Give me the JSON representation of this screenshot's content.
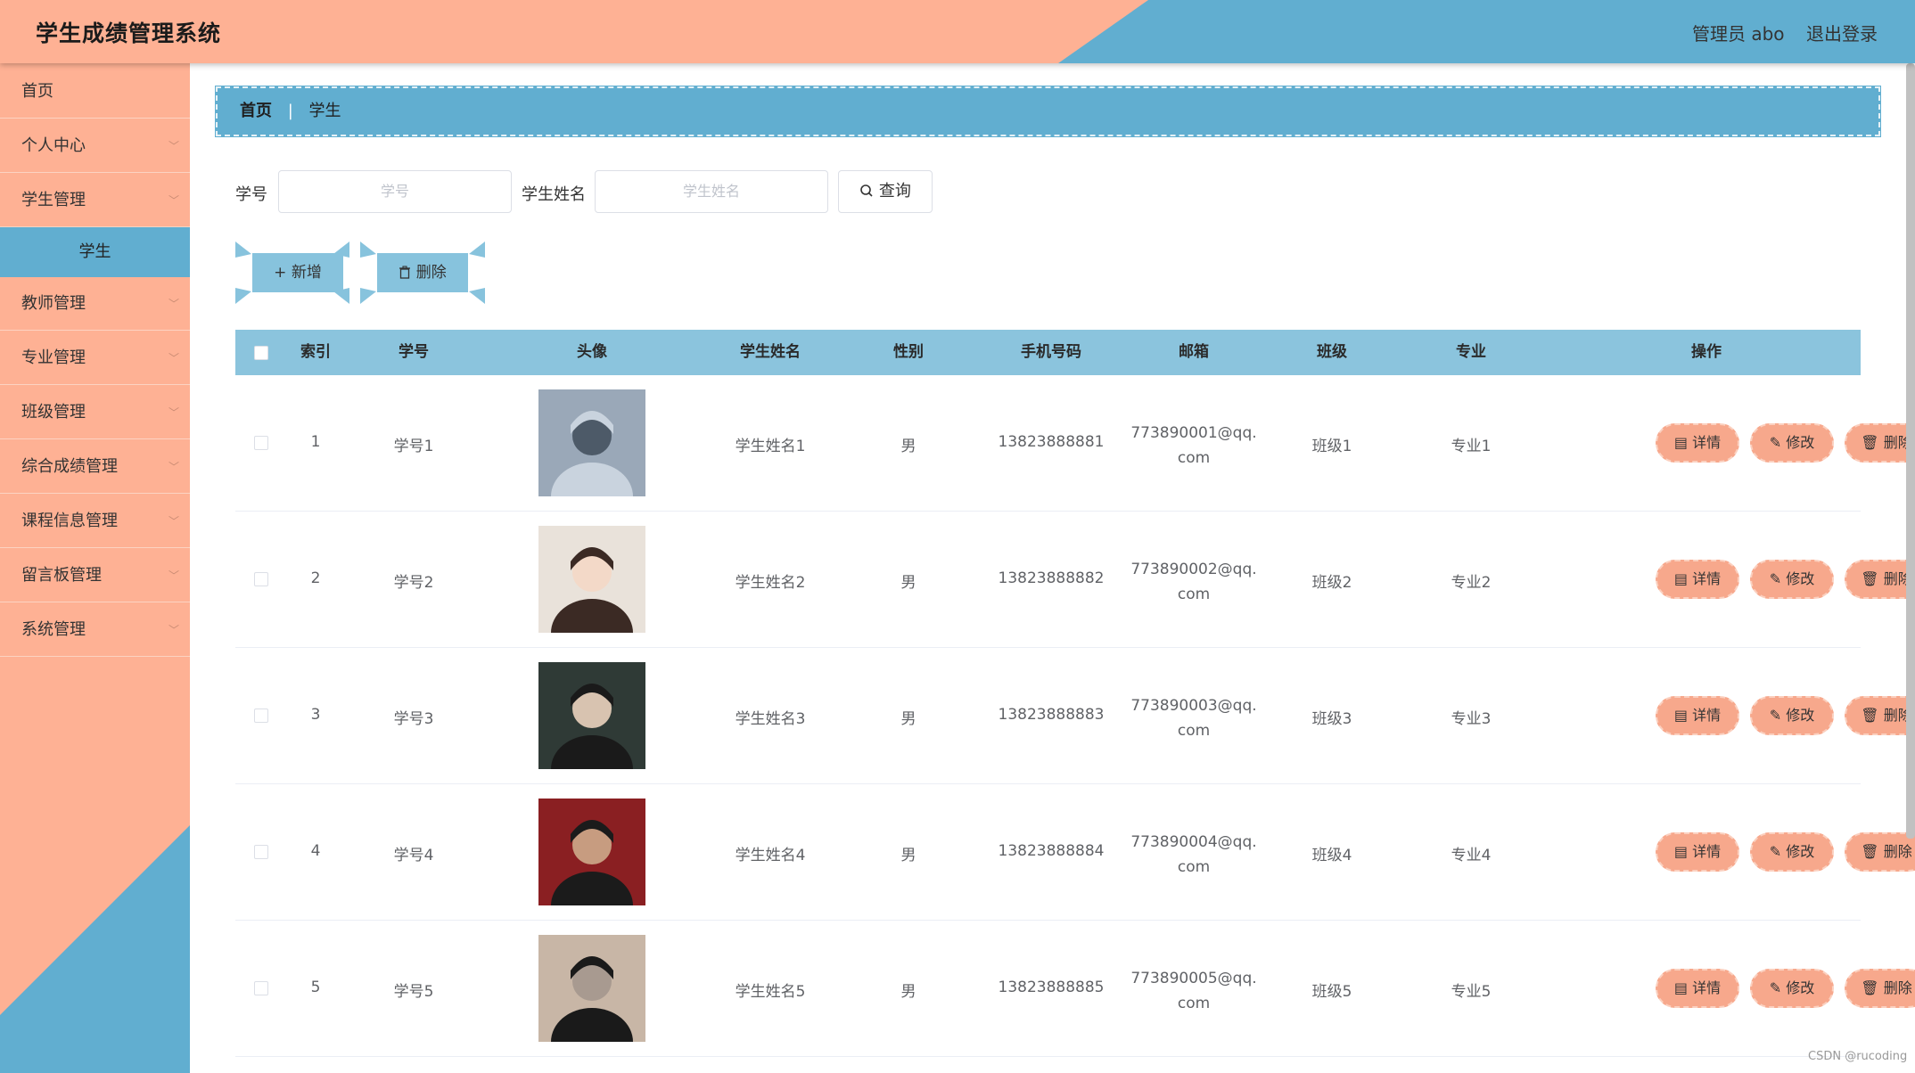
{
  "header": {
    "title": "学生成绩管理系统",
    "admin_label": "管理员 abo",
    "logout_label": "退出登录"
  },
  "sidebar": {
    "items": [
      {
        "label": "首页"
      },
      {
        "label": "个人中心"
      },
      {
        "label": "学生管理"
      },
      {
        "label": "学生"
      },
      {
        "label": "教师管理"
      },
      {
        "label": "专业管理"
      },
      {
        "label": "班级管理"
      },
      {
        "label": "综合成绩管理"
      },
      {
        "label": "课程信息管理"
      },
      {
        "label": "留言板管理"
      },
      {
        "label": "系统管理"
      }
    ]
  },
  "breadcrumb": {
    "home": "首页",
    "separator": "|",
    "current": "学生"
  },
  "search": {
    "id_label": "学号",
    "id_placeholder": "学号",
    "name_label": "学生姓名",
    "name_placeholder": "学生姓名",
    "query_label": "查询"
  },
  "actions": {
    "add_label": "新增",
    "delete_label": "删除"
  },
  "table": {
    "headers": [
      "索引",
      "学号",
      "头像",
      "学生姓名",
      "性别",
      "手机号码",
      "邮箱",
      "班级",
      "专业",
      "操作"
    ],
    "rows": [
      {
        "index": "1",
        "sid": "学号1",
        "name": "学生姓名1",
        "gender": "男",
        "phone": "13823888881",
        "email1": "773890001@qq.",
        "email2": "com",
        "class": "班级1",
        "major": "专业1"
      },
      {
        "index": "2",
        "sid": "学号2",
        "name": "学生姓名2",
        "gender": "男",
        "phone": "13823888882",
        "email1": "773890002@qq.",
        "email2": "com",
        "class": "班级2",
        "major": "专业2"
      },
      {
        "index": "3",
        "sid": "学号3",
        "name": "学生姓名3",
        "gender": "男",
        "phone": "13823888883",
        "email1": "773890003@qq.",
        "email2": "com",
        "class": "班级3",
        "major": "专业3"
      },
      {
        "index": "4",
        "sid": "学号4",
        "name": "学生姓名4",
        "gender": "男",
        "phone": "13823888884",
        "email1": "773890004@qq.",
        "email2": "com",
        "class": "班级4",
        "major": "专业4"
      },
      {
        "index": "5",
        "sid": "学号5",
        "name": "学生姓名5",
        "gender": "男",
        "phone": "13823888885",
        "email1": "773890005@qq.",
        "email2": "com",
        "class": "班级5",
        "major": "专业5"
      }
    ],
    "op_labels": {
      "detail": "详情",
      "edit": "修改",
      "delete": "删除"
    }
  },
  "watermark": "CSDN @rucoding",
  "colors": {
    "peach": "#feb194",
    "blue": "#61aed0",
    "table_head": "#8bc4dd",
    "op_button": "#f7a88c"
  }
}
